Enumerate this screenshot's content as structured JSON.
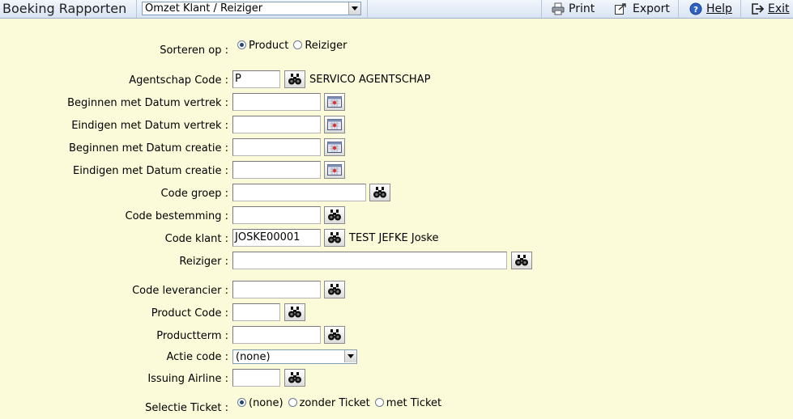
{
  "toolbar": {
    "title": "Boeking Rapporten",
    "report_select": "Omzet Klant / Reiziger",
    "print_label": "Print",
    "export_label": "Export",
    "help_label": "Help",
    "exit_label": "Exit"
  },
  "form": {
    "sort": {
      "label": "Sorteren op :",
      "options": [
        "Product",
        "Reiziger"
      ],
      "selected": "Product"
    },
    "agency_code": {
      "label": "Agentschap Code :",
      "value": "P",
      "info": "SERVICO AGENTSCHAP"
    },
    "start_departure": {
      "label": "Beginnen met Datum vertrek :",
      "value": ""
    },
    "end_departure": {
      "label": "Eindigen met Datum vertrek :",
      "value": ""
    },
    "start_creation": {
      "label": "Beginnen met Datum creatie :",
      "value": ""
    },
    "end_creation": {
      "label": "Eindigen met Datum creatie :",
      "value": ""
    },
    "group_code": {
      "label": "Code groep :",
      "value": ""
    },
    "destination_code": {
      "label": "Code bestemming :",
      "value": ""
    },
    "customer_code": {
      "label": "Code klant :",
      "value": "JOSKE00001",
      "info": "TEST JEFKE Joske"
    },
    "traveler": {
      "label": "Reiziger :",
      "value": ""
    },
    "supplier_code": {
      "label": "Code leverancier :",
      "value": ""
    },
    "product_code": {
      "label": "Product Code :",
      "value": ""
    },
    "product_term": {
      "label": "Productterm :",
      "value": ""
    },
    "action_code": {
      "label": "Actie code :",
      "value": "(none)"
    },
    "issuing_airline": {
      "label": "Issuing Airline :",
      "value": ""
    },
    "ticket_selection": {
      "label": "Selectie Ticket :",
      "options": [
        "(none)",
        "zonder Ticket",
        "met Ticket"
      ],
      "selected": "(none)"
    }
  },
  "colors": {
    "background": "#fbfbd9",
    "toolbar": "#d9e4f3"
  }
}
